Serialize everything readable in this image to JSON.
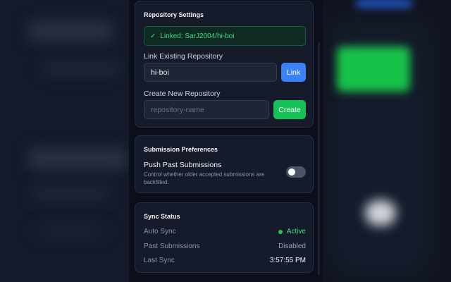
{
  "repository_settings": {
    "title": "Repository Settings",
    "linked_status": "Linked: SarJ2004/hi-boi",
    "link_existing_label": "Link Existing Repository",
    "link_input_value": "hi-boi",
    "link_button": "Link",
    "create_new_label": "Create New Repository",
    "create_input_placeholder": "repository-name",
    "create_button": "Create"
  },
  "submission_preferences": {
    "title": "Submission Preferences",
    "push_past_title": "Push Past Submissions",
    "push_past_desc": "Control whether older accepted submissions are backfilled.",
    "push_past_enabled": false
  },
  "sync_status": {
    "title": "Sync Status",
    "rows": [
      {
        "key": "Auto Sync",
        "value": "Active"
      },
      {
        "key": "Past Submissions",
        "value": "Disabled"
      },
      {
        "key": "Last Sync",
        "value": "3:57:55 PM"
      }
    ]
  },
  "colors": {
    "accent_blue": "#3b82f6",
    "accent_green": "#16c157",
    "panel_bg": "#0b0f19",
    "card_bg": "#151b2b"
  },
  "icons": {
    "linked": "check-icon",
    "active": "status-dot-icon"
  }
}
